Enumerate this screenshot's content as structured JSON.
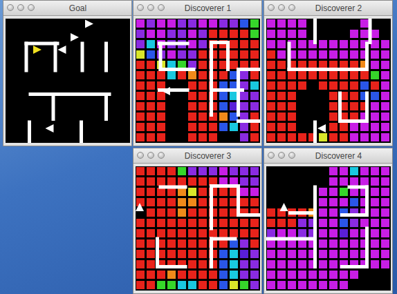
{
  "palette": {
    "R": "#e8231b",
    "M": "#c81ee6",
    "P": "#8a2be2",
    "V": "#5a1fd8",
    "B": "#2a56e8",
    "C": "#19c8e0",
    "G": "#36d62a",
    "Y": "#d8e62a",
    "O": "#f08a1a",
    "K": "#000000"
  },
  "windows": [
    {
      "title": "Goal",
      "rows": [],
      "walls": [
        [
          2,
          2.4,
          5,
          2.4
        ],
        [
          2,
          2.4,
          2,
          5
        ],
        [
          4.8,
          2.4,
          4.8,
          5
        ],
        [
          7.4,
          2.4,
          7.4,
          5
        ],
        [
          9.7,
          2.4,
          9.7,
          5
        ],
        [
          2.4,
          7.3,
          10,
          7.3
        ],
        [
          4.6,
          7.3,
          4.6,
          9.7
        ],
        [
          9.7,
          7.3,
          9.7,
          9.7
        ],
        [
          2.3,
          10,
          2.3,
          12
        ],
        [
          7.3,
          10,
          7.3,
          12
        ]
      ],
      "agents": [
        {
          "x": 3,
          "y": 3,
          "direction": "right",
          "color": "#f0e020"
        },
        {
          "x": 5.5,
          "y": 3,
          "direction": "left",
          "color": "#ffffff"
        },
        {
          "x": 6.6,
          "y": 1.8,
          "direction": "right",
          "color": "#ffffff"
        },
        {
          "x": 8,
          "y": 0.5,
          "direction": "right",
          "color": "#ffffff"
        },
        {
          "x": 4.3,
          "y": 10.6,
          "direction": "left",
          "color": "#ffffff"
        }
      ]
    },
    {
      "title": "Discoverer 1",
      "rows": [
        "MPMMPPMMPPBG",
        "PMMPPMPRRRRG",
        "PCMPPMPRRRRR",
        "YBPMPPRRRRRR",
        "RRYCGPRRRRRR",
        "RRRCRORRRBPR",
        "RRRKKRRRBBPC",
        "RRRKKRRRBCPP",
        "RRRKKRRRBVPP",
        "RRRKKRRROBPR",
        "RRRKKRRRBCPR",
        "RRRKKRRRKKPR"
      ],
      "walls": [
        [
          2.3,
          2.4,
          5,
          2.4
        ],
        [
          2.4,
          2.4,
          2.4,
          4.9
        ],
        [
          2.4,
          4.9,
          5.6,
          4.9
        ],
        [
          7.3,
          2.3,
          7.3,
          9.3
        ],
        [
          7.3,
          2.3,
          8.9,
          2.3
        ],
        [
          8.9,
          2.3,
          8.9,
          4.9
        ],
        [
          2.3,
          6.9,
          5,
          6.9
        ],
        [
          7.3,
          6.9,
          10.3,
          6.9
        ],
        [
          9.9,
          4.9,
          9.9,
          9.3
        ],
        [
          9.9,
          4.9,
          12,
          4.9
        ],
        [
          9.9,
          9.9,
          12,
          9.9
        ]
      ],
      "agents": [
        {
          "x": 3,
          "y": 7,
          "direction": "left",
          "color": "#ffffff"
        }
      ]
    },
    {
      "title": "Discoverer 2",
      "rows": [
        "MMMMKKKKKMKK",
        "MMMMKKKKMMMK",
        "MMMMMMMMMMMM",
        "RMMMMMMMMMMM",
        "RRRRRRRRROMM",
        "RRRRRRRRRRGM",
        "RRRRKRRRRBRM",
        "RRRKKKRRRBBM",
        "RRRKKKRRRRMM",
        "RRRKKKRRRMMM",
        "RRRKKKRRMMMM",
        "RRRRRYRRMMMM"
      ],
      "walls": [
        [
          4.7,
          0,
          4.7,
          2.3
        ],
        [
          10,
          0,
          10,
          2.3
        ],
        [
          2.2,
          2.4,
          2.2,
          4.9
        ],
        [
          2.2,
          4.9,
          9.7,
          4.9
        ],
        [
          9.7,
          2.4,
          9.7,
          4.9
        ],
        [
          7.1,
          7.2,
          7.1,
          9.9
        ],
        [
          7.1,
          9.9,
          9.7,
          9.9
        ],
        [
          9.7,
          7.2,
          9.7,
          9.9
        ],
        [
          4.7,
          10,
          4.7,
          12
        ]
      ],
      "agents": [
        {
          "x": 5.4,
          "y": 10.6,
          "direction": "left",
          "color": "#ffffff"
        }
      ]
    },
    {
      "title": "Discoverer 3",
      "rows": [
        "RRRRGPPPMPPP",
        "RRRRRRRRMMPP",
        "RRRROYRRRRMM",
        "RRRROORRRRRR",
        "KRRRORRRRRRR",
        "RRRRRRRRRRRR",
        "RRRRRRRRRRRR",
        "RRRRRRRRRBPR",
        "RRRRRRRRBCVP",
        "RRRRRRRRBCPP",
        "RRRORRRRBCPP",
        "RRGGCCRRBYGP"
      ],
      "walls": [
        [
          2.4,
          2,
          4.8,
          2
        ],
        [
          7.3,
          1.9,
          7.3,
          6
        ],
        [
          7.3,
          1.9,
          9.9,
          1.9
        ],
        [
          9.9,
          1.9,
          9.9,
          4.7
        ],
        [
          9.9,
          4.7,
          12,
          4.7
        ],
        [
          2.1,
          7,
          2.1,
          9.7
        ],
        [
          2.1,
          9.7,
          4.8,
          9.7
        ],
        [
          7.3,
          7,
          7.3,
          9.7
        ],
        [
          7.3,
          7,
          9.6,
          7
        ]
      ],
      "agents": [
        {
          "x": 0.4,
          "y": 4,
          "direction": "up",
          "color": "#ffffff"
        }
      ]
    },
    {
      "title": "Discoverer 4",
      "rows": [
        "KKKKKKMMCMMM",
        "KKKKKKMMMMMM",
        "KKKKKMMGMMMM",
        "KKKKKMMMBMMM",
        "RRRROMMBPMMM",
        "RRRPPMMBPMMM",
        "PMMPPMMVMMMM",
        "MMMMMMMMMMMM",
        "MMMMMMMMMMMM",
        "MMMMMMMMMMMM",
        "MMMMMMMMMKKK",
        "MMMMMMMMKKKK"
      ],
      "walls": [
        [
          4.7,
          2,
          4.7,
          9.7
        ],
        [
          2.3,
          4.5,
          4.7,
          4.5
        ],
        [
          0,
          7,
          4.7,
          7
        ],
        [
          9.7,
          2,
          9.7,
          4.7
        ],
        [
          8,
          2,
          9.7,
          2
        ],
        [
          7.3,
          4.7,
          9.7,
          4.7
        ],
        [
          9.7,
          6,
          9.7,
          9.7
        ],
        [
          7.3,
          9.7,
          9.7,
          9.7
        ]
      ],
      "agents": [
        {
          "x": 1.7,
          "y": 4,
          "direction": "up",
          "color": "#ffffff"
        }
      ]
    }
  ]
}
